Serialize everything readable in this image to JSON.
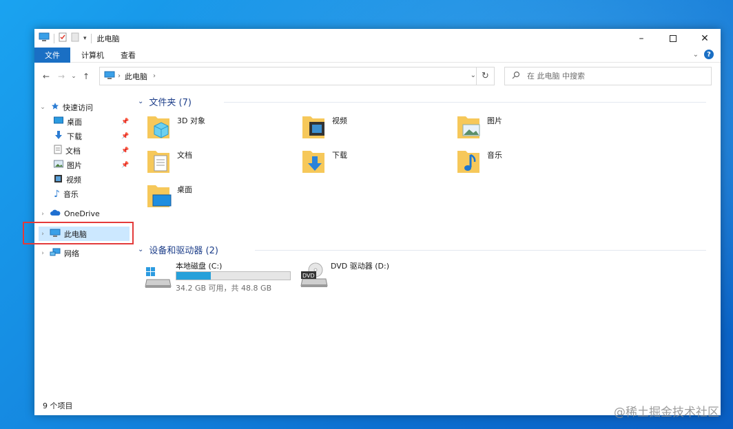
{
  "window": {
    "title": "此电脑"
  },
  "ribbon": {
    "tabs": [
      "文件",
      "计算机",
      "查看"
    ]
  },
  "address": {
    "path": "此电脑",
    "chevron": "›"
  },
  "search": {
    "placeholder": "在 此电脑 中搜索"
  },
  "sidebar": {
    "quick_access": "快速访问",
    "quick_items": [
      "桌面",
      "下载",
      "文档",
      "图片",
      "视频",
      "音乐"
    ],
    "onedrive": "OneDrive",
    "this_pc": "此电脑",
    "network": "网络"
  },
  "groups": {
    "folders_title": "文件夹 (7)",
    "folders": [
      "3D 对象",
      "视频",
      "图片",
      "文档",
      "下载",
      "音乐",
      "桌面"
    ],
    "devices_title": "设备和驱动器 (2)",
    "drive_c": {
      "label": "本地磁盘 (C:)",
      "usage": "34.2 GB 可用，共 48.8 GB",
      "used_fraction": 0.3
    },
    "drive_d": {
      "label": "DVD 驱动器 (D:)",
      "badge": "DVD"
    }
  },
  "status": {
    "count": "9 个项目"
  },
  "watermark": "@稀土掘金技术社区",
  "colors": {
    "accent": "#1a6fc4",
    "selected": "#cce8ff",
    "highlight": "#e33a3a",
    "progress": "#26a0da"
  }
}
